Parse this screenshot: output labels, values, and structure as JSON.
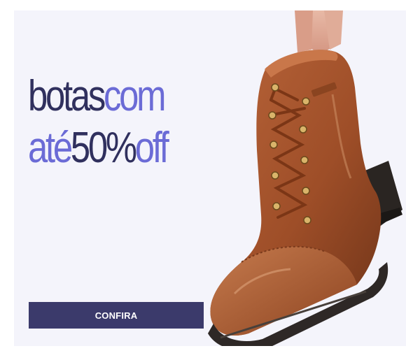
{
  "promo": {
    "headline": {
      "line1": {
        "part_dark": "botas",
        "part_light": "com"
      },
      "line2": {
        "part_light": "até",
        "part_dark": "50%",
        "part_light2": "off"
      }
    },
    "cta_label": "CONFIRA"
  },
  "colors": {
    "background": "#f4f4fb",
    "headline_dark": "#30305e",
    "headline_light": "#6b6bd6",
    "button": "#3b3a6b",
    "boot_leather": "#a8552a"
  },
  "image": {
    "subject": "boot-image"
  }
}
